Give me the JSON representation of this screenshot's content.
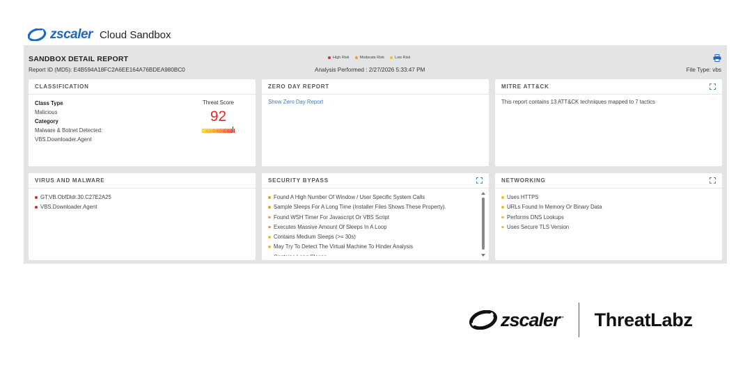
{
  "header": {
    "brand": "zscaler",
    "product": "Cloud Sandbox"
  },
  "report": {
    "title": "SANDBOX DETAIL REPORT",
    "report_id": "Report ID (MD5): E4B594A18FC2A6EE164A76BDEA980BC0",
    "analysis": "Analysis Performed : 2/27/2026 5:33:47 PM",
    "file_type": "File Type: vbs",
    "legend": [
      {
        "label": "High Risk",
        "color": "#e02a2a"
      },
      {
        "label": "Moderate Risk",
        "color": "#f0a020"
      },
      {
        "label": "Low Risk",
        "color": "#f0c419"
      }
    ]
  },
  "classification": {
    "title": "CLASSIFICATION",
    "class_type_label": "Class Type",
    "class_type_value": "Malicious",
    "category_label": "Category",
    "category_value": "Malware & Botnet Detected:",
    "detail": "VBS.Downloader.Agent",
    "threat_score_label": "Threat Score",
    "threat_score": "92"
  },
  "zero_day": {
    "title": "ZERO DAY REPORT",
    "link": "Show Zero Day Report"
  },
  "mitre": {
    "title": "MITRE ATT&CK",
    "text": "This report contains 13 ATT&CK techniques mapped to 7 tactics"
  },
  "virus": {
    "title": "VIRUS AND MALWARE",
    "items": [
      {
        "text": "GT:VB.ObfDldr.30.C27E2A25",
        "color": "#e02a2a"
      },
      {
        "text": "VBS.Downloader.Agent",
        "color": "#e02a2a"
      }
    ]
  },
  "security_bypass": {
    "title": "SECURITY BYPASS",
    "items": [
      {
        "text": "Found A High Number Of Window / User Specific System Calls",
        "color": "#f0a020"
      },
      {
        "text": "Sample Sleeps For A Long Time (Installer Files Shows These Property).",
        "color": "#f0a020"
      },
      {
        "text": "Found WSH Timer For Javascript Or VBS Script",
        "color": "#f0a020"
      },
      {
        "text": "Executes Massive Amount Of Sleeps In A Loop",
        "color": "#f0a020"
      },
      {
        "text": "Contains Medium Sleeps (>= 30s)",
        "color": "#f0c419"
      },
      {
        "text": "May Try To Detect The Virtual Machine To Hinder Analysis",
        "color": "#f0c419"
      },
      {
        "text": "Contains Long Sleeps",
        "color": "#f0c419"
      }
    ]
  },
  "networking": {
    "title": "NETWORKING",
    "items": [
      {
        "text": "Uses HTTPS",
        "color": "#f0c419"
      },
      {
        "text": "URLs Found In Memory Or Binary Data",
        "color": "#f0c419"
      },
      {
        "text": "Performs DNS Lookups",
        "color": "#f0c419"
      },
      {
        "text": "Uses Secure TLS Version",
        "color": "#f0c419"
      }
    ]
  },
  "footer": {
    "brand": "zscaler",
    "trademark": "™",
    "partner": "ThreatLabz"
  },
  "colors": {
    "brand_blue": "#1f67c6",
    "link": "#3a7bbf",
    "panel_bg": "#e3e4e6"
  }
}
